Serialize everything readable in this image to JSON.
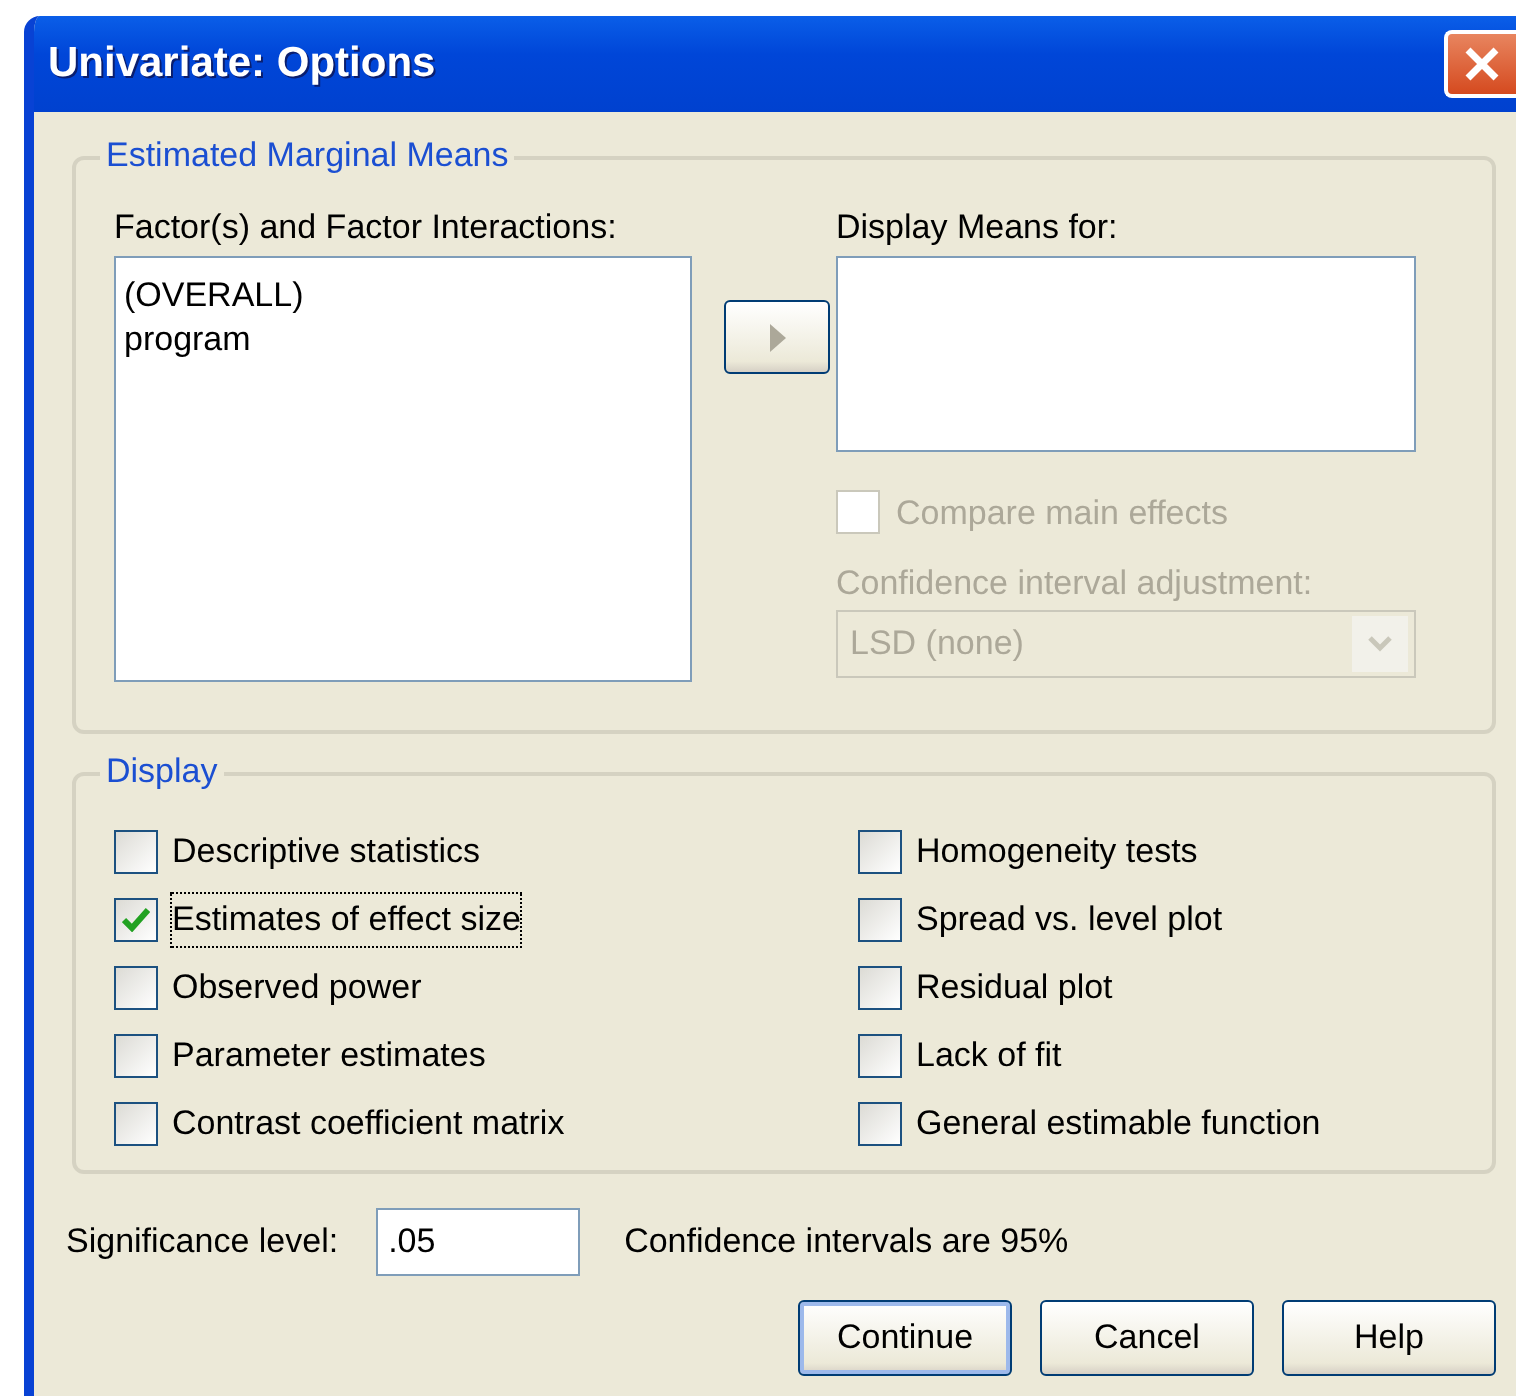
{
  "window": {
    "title": "Univariate: Options"
  },
  "estimated_marginal_means": {
    "legend": "Estimated Marginal Means",
    "factors": {
      "label": "Factor(s) and Factor Interactions:",
      "items": [
        {
          "text": "(OVERALL)",
          "selected": false
        },
        {
          "text": "program",
          "selected": false
        }
      ]
    },
    "move_button": {
      "disabled": true
    },
    "display_means": {
      "label": "Display Means for:"
    },
    "compare_main_effects": {
      "label": "Compare main effects",
      "checked": false,
      "disabled": true
    },
    "ci_adjustment": {
      "label": "Confidence interval adjustment:",
      "value": "LSD (none)",
      "disabled": true
    }
  },
  "display": {
    "legend": "Display",
    "options": [
      {
        "label": "Descriptive statistics",
        "checked": false,
        "focused": false
      },
      {
        "label": "Estimates of effect size",
        "checked": true,
        "focused": true
      },
      {
        "label": "Observed power",
        "checked": false,
        "focused": false
      },
      {
        "label": "Parameter estimates",
        "checked": false,
        "focused": false
      },
      {
        "label": "Contrast coefficient matrix",
        "checked": false,
        "focused": false
      },
      {
        "label": "Homogeneity tests",
        "checked": false,
        "focused": false
      },
      {
        "label": "Spread vs. level plot",
        "checked": false,
        "focused": false
      },
      {
        "label": "Residual plot",
        "checked": false,
        "focused": false
      },
      {
        "label": "Lack of fit",
        "checked": false,
        "focused": false
      },
      {
        "label": "General estimable function",
        "checked": false,
        "focused": false
      }
    ]
  },
  "significance": {
    "label": "Significance level:",
    "value": ".05"
  },
  "confidence_note": "Confidence intervals are 95%",
  "buttons": [
    {
      "label": "Continue",
      "default": true
    },
    {
      "label": "Cancel",
      "default": false
    },
    {
      "label": "Help",
      "default": false
    }
  ]
}
